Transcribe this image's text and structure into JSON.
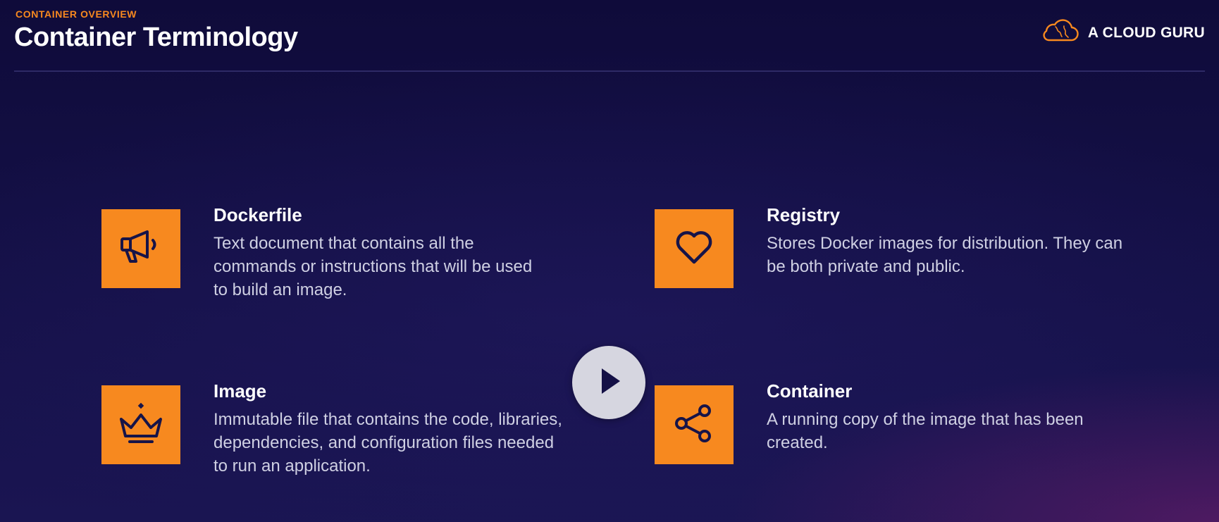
{
  "header": {
    "eyebrow": "CONTAINER OVERVIEW",
    "title": "Container Terminology",
    "logo_text": "A CLOUD GURU"
  },
  "colors": {
    "accent": "#f7891f",
    "background": "#141046",
    "icon_stroke": "#171448"
  },
  "items": [
    {
      "title": "Dockerfile",
      "description": "Text document that contains all the commands or instructions that will be used to build an image.",
      "icon": "megaphone-icon"
    },
    {
      "title": "Registry",
      "description": "Stores Docker images for distribution. They can be both private and public.",
      "icon": "heart-icon"
    },
    {
      "title": "Image",
      "description": "Immutable file that contains the code, libraries, dependencies, and configuration files needed to run an application.",
      "icon": "crown-icon"
    },
    {
      "title": "Container",
      "description": "A running copy of the image that has been created.",
      "icon": "share-icon"
    }
  ],
  "player": {
    "control": "play-icon"
  }
}
